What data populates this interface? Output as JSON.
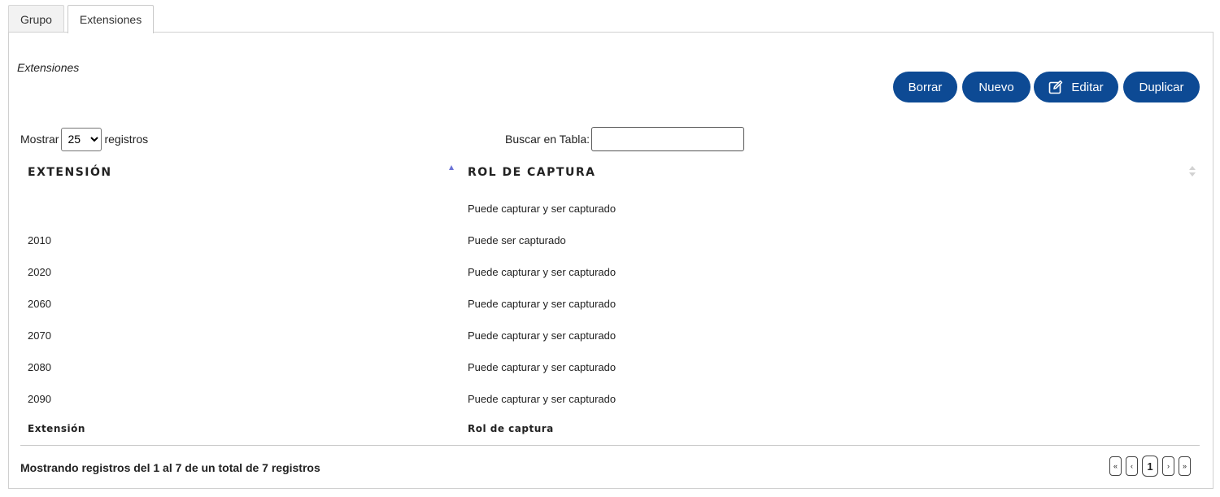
{
  "tabs": [
    {
      "label": "Grupo"
    },
    {
      "label": "Extensiones"
    }
  ],
  "section_title": "Extensiones",
  "buttons": {
    "borrar": "Borrar",
    "nuevo": "Nuevo",
    "editar": "Editar",
    "editar_icon": "edit-icon",
    "duplicar": "Duplicar"
  },
  "colors": {
    "button_bg": "#0d4a94",
    "sort_active": "#6b73d6"
  },
  "length_menu": {
    "prefix": "Mostrar",
    "value": "25",
    "suffix": "registros"
  },
  "search": {
    "label": "Buscar en Tabla:",
    "value": ""
  },
  "table": {
    "headers": [
      "EXTENSIÓN",
      "ROL DE CAPTURA"
    ],
    "rows": [
      {
        "extension": "",
        "rol": "Puede capturar y ser capturado"
      },
      {
        "extension": "2010",
        "rol": "Puede ser capturado"
      },
      {
        "extension": "2020",
        "rol": "Puede capturar y ser capturado"
      },
      {
        "extension": "2060",
        "rol": "Puede capturar y ser capturado"
      },
      {
        "extension": "2070",
        "rol": "Puede capturar y ser capturado"
      },
      {
        "extension": "2080",
        "rol": "Puede capturar y ser capturado"
      },
      {
        "extension": "2090",
        "rol": "Puede capturar y ser capturado"
      }
    ],
    "footers": [
      "Extensión",
      "Rol de captura"
    ]
  },
  "info": "Mostrando registros del 1 al 7 de un total de 7 registros",
  "pagination": {
    "first": "«",
    "prev": "‹",
    "current": "1",
    "next": "›",
    "last": "»"
  }
}
